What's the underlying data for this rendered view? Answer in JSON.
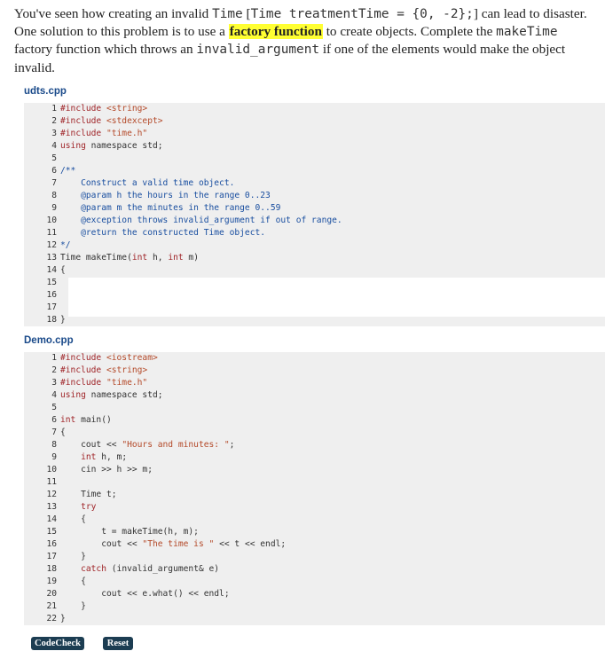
{
  "intro": {
    "text1": "You've seen how creating an invalid ",
    "code1": "Time",
    "text2": " [",
    "code2": "Time treatmentTime = {0, -2};",
    "text3": "] can lead to disaster. One solution to this problem is to use a ",
    "highlight": "factory function",
    "text4": " to create objects. Complete the ",
    "code3": "makeTime",
    "text5": " factory function which throws an ",
    "code4": "invalid_argument",
    "text6": " if one of the elements would make the object invalid."
  },
  "files": [
    {
      "name": "udts.cpp",
      "lines": [
        {
          "n": "1",
          "segs": [
            {
              "t": "#include ",
              "c": "kw"
            },
            {
              "t": "<string>",
              "c": "st"
            }
          ]
        },
        {
          "n": "2",
          "segs": [
            {
              "t": "#include ",
              "c": "kw"
            },
            {
              "t": "<stdexcept>",
              "c": "st"
            }
          ]
        },
        {
          "n": "3",
          "segs": [
            {
              "t": "#include ",
              "c": "kw"
            },
            {
              "t": "\"time.h\"",
              "c": "st"
            }
          ]
        },
        {
          "n": "4",
          "segs": [
            {
              "t": "using",
              "c": "kw"
            },
            {
              "t": " namespace std;",
              "c": ""
            }
          ]
        },
        {
          "n": "5",
          "segs": []
        },
        {
          "n": "6",
          "segs": [
            {
              "t": "/**",
              "c": "cm"
            }
          ]
        },
        {
          "n": "7",
          "segs": [
            {
              "t": "    Construct a valid time object.",
              "c": "cm"
            }
          ]
        },
        {
          "n": "8",
          "segs": [
            {
              "t": "    @param h the hours in the range 0..23",
              "c": "cm"
            }
          ]
        },
        {
          "n": "9",
          "segs": [
            {
              "t": "    @param m the minutes in the range 0..59",
              "c": "cm"
            }
          ]
        },
        {
          "n": "10",
          "segs": [
            {
              "t": "    @exception throws invalid_argument if out of range.",
              "c": "cm"
            }
          ]
        },
        {
          "n": "11",
          "segs": [
            {
              "t": "    @return the constructed Time object.",
              "c": "cm"
            }
          ]
        },
        {
          "n": "12",
          "segs": [
            {
              "t": "*/",
              "c": "cm"
            }
          ]
        },
        {
          "n": "13",
          "segs": [
            {
              "t": "Time makeTime(",
              "c": ""
            },
            {
              "t": "int",
              "c": "kw"
            },
            {
              "t": " h, ",
              "c": ""
            },
            {
              "t": "int",
              "c": "kw"
            },
            {
              "t": " m)",
              "c": ""
            }
          ]
        },
        {
          "n": "14",
          "segs": [
            {
              "t": "{",
              "c": ""
            }
          ]
        },
        {
          "n": "15",
          "segs": []
        },
        {
          "n": "16",
          "segs": []
        },
        {
          "n": "17",
          "segs": []
        },
        {
          "n": "18",
          "segs": [
            {
              "t": "}",
              "c": ""
            }
          ]
        }
      ]
    },
    {
      "name": "Demo.cpp",
      "lines": [
        {
          "n": "1",
          "segs": [
            {
              "t": "#include ",
              "c": "kw"
            },
            {
              "t": "<iostream>",
              "c": "st"
            }
          ]
        },
        {
          "n": "2",
          "segs": [
            {
              "t": "#include ",
              "c": "kw"
            },
            {
              "t": "<string>",
              "c": "st"
            }
          ]
        },
        {
          "n": "3",
          "segs": [
            {
              "t": "#include ",
              "c": "kw"
            },
            {
              "t": "\"time.h\"",
              "c": "st"
            }
          ]
        },
        {
          "n": "4",
          "segs": [
            {
              "t": "using",
              "c": "kw"
            },
            {
              "t": " namespace std;",
              "c": ""
            }
          ]
        },
        {
          "n": "5",
          "segs": []
        },
        {
          "n": "6",
          "segs": [
            {
              "t": "int",
              "c": "kw"
            },
            {
              "t": " main()",
              "c": ""
            }
          ]
        },
        {
          "n": "7",
          "segs": [
            {
              "t": "{",
              "c": ""
            }
          ]
        },
        {
          "n": "8",
          "segs": [
            {
              "t": "    cout << ",
              "c": ""
            },
            {
              "t": "\"Hours and minutes: \"",
              "c": "st"
            },
            {
              "t": ";",
              "c": ""
            }
          ]
        },
        {
          "n": "9",
          "segs": [
            {
              "t": "    ",
              "c": ""
            },
            {
              "t": "int",
              "c": "kw"
            },
            {
              "t": " h, m;",
              "c": ""
            }
          ]
        },
        {
          "n": "10",
          "segs": [
            {
              "t": "    cin >> h >> m;",
              "c": ""
            }
          ]
        },
        {
          "n": "11",
          "segs": []
        },
        {
          "n": "12",
          "segs": [
            {
              "t": "    Time t;",
              "c": ""
            }
          ]
        },
        {
          "n": "13",
          "segs": [
            {
              "t": "    ",
              "c": ""
            },
            {
              "t": "try",
              "c": "kw"
            }
          ]
        },
        {
          "n": "14",
          "segs": [
            {
              "t": "    {",
              "c": ""
            }
          ]
        },
        {
          "n": "15",
          "segs": [
            {
              "t": "        t = makeTime(h, m);",
              "c": ""
            }
          ]
        },
        {
          "n": "16",
          "segs": [
            {
              "t": "        cout << ",
              "c": ""
            },
            {
              "t": "\"The time is \"",
              "c": "st"
            },
            {
              "t": " << t << endl;",
              "c": ""
            }
          ]
        },
        {
          "n": "17",
          "segs": [
            {
              "t": "    }",
              "c": ""
            }
          ]
        },
        {
          "n": "18",
          "segs": [
            {
              "t": "    ",
              "c": ""
            },
            {
              "t": "catch",
              "c": "kw"
            },
            {
              "t": " (invalid_argument& e)",
              "c": ""
            }
          ]
        },
        {
          "n": "19",
          "segs": [
            {
              "t": "    {",
              "c": ""
            }
          ]
        },
        {
          "n": "20",
          "segs": [
            {
              "t": "        cout << e.what() << endl;",
              "c": ""
            }
          ]
        },
        {
          "n": "21",
          "segs": [
            {
              "t": "    }",
              "c": ""
            }
          ]
        },
        {
          "n": "22",
          "segs": [
            {
              "t": "}",
              "c": ""
            }
          ]
        }
      ]
    }
  ],
  "editor": {
    "value": ""
  },
  "buttons": {
    "check": "CodeCheck",
    "reset": "Reset"
  }
}
